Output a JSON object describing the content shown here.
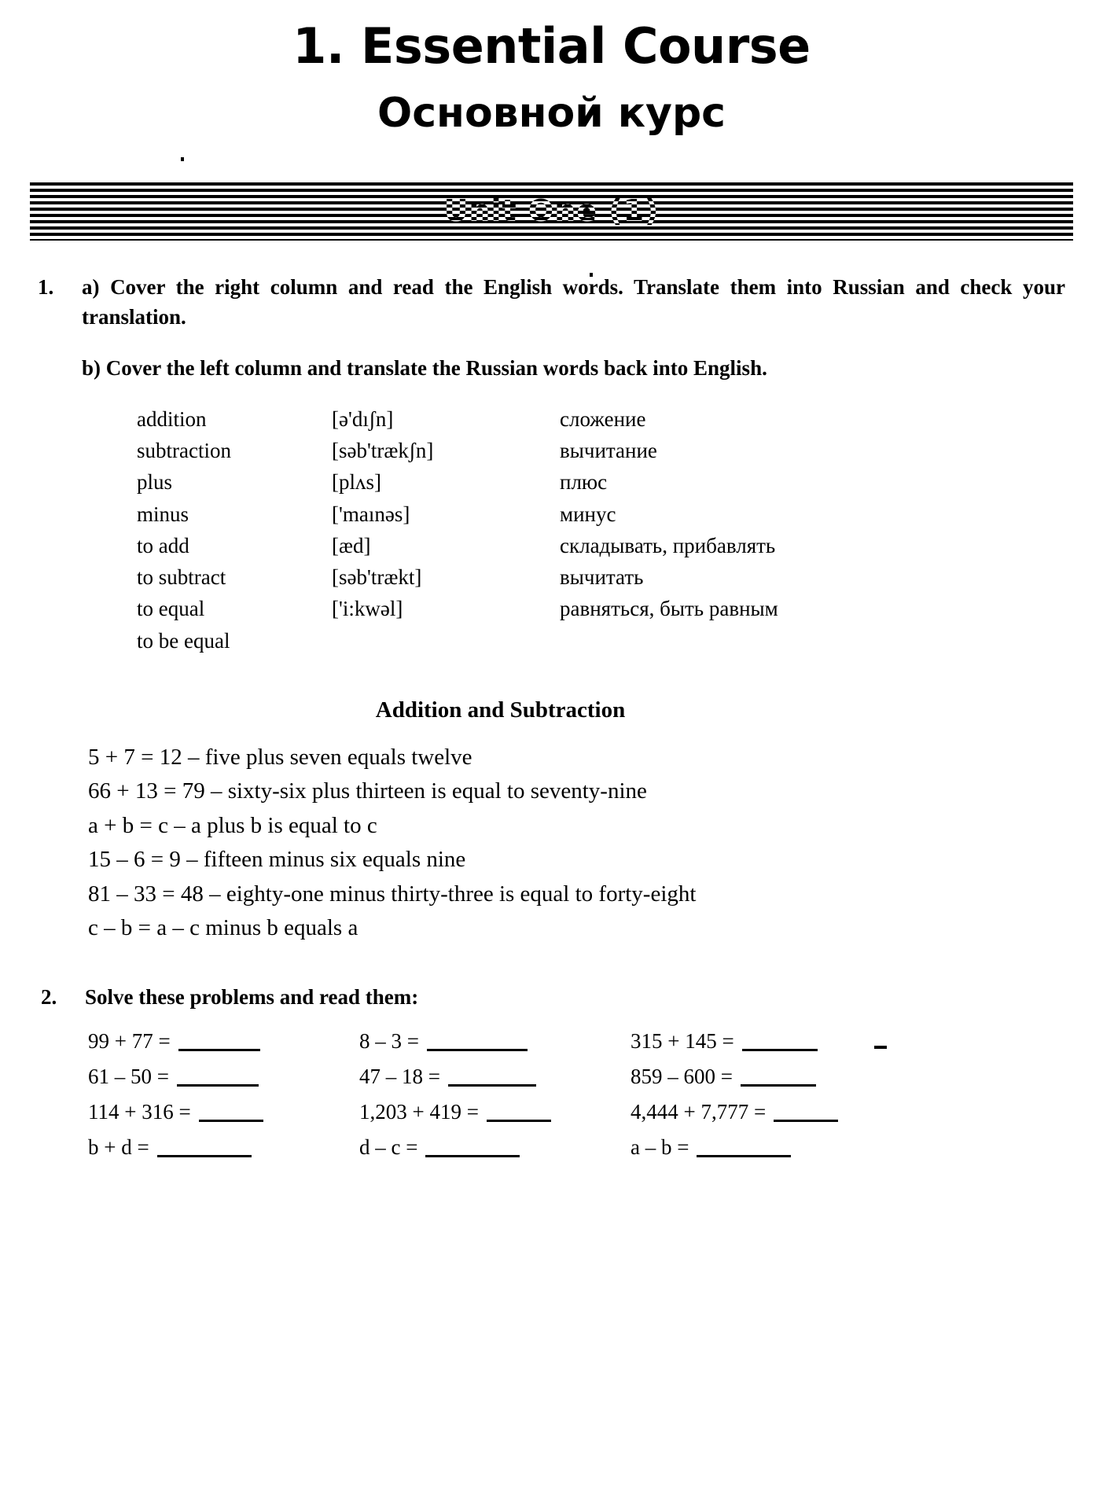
{
  "header": {
    "title_en": "1. Essential Course",
    "title_ru": "Основной курс",
    "unit_banner": "Unit One (1)"
  },
  "exercise1": {
    "number": "1.",
    "instruction_a": "a) Cover the right column and read the English words. Translate them into Russian and check your translation.",
    "instruction_b": "b) Cover the left column and translate the Russian words back into English.",
    "vocabulary": [
      {
        "english": "addition",
        "ipa": "[ə'dıʃn]",
        "russian": "сложение"
      },
      {
        "english": "subtraction",
        "ipa": "[səb'trækʃn]",
        "russian": "вычитание"
      },
      {
        "english": "plus",
        "ipa": "[plʌs]",
        "russian": "плюс"
      },
      {
        "english": "minus",
        "ipa": "['maınəs]",
        "russian": "минус"
      },
      {
        "english": "to add",
        "ipa": "[æd]",
        "russian": "складывать, прибавлять"
      },
      {
        "english": "to subtract",
        "ipa": "[səb'trækt]",
        "russian": "вычитать"
      },
      {
        "english": "to equal",
        "ipa": "['i:kwəl]",
        "russian": "равняться, быть равным"
      },
      {
        "english": "to be equal",
        "ipa": "",
        "russian": ""
      }
    ]
  },
  "addition_subtraction": {
    "heading": "Addition and Subtraction",
    "examples": [
      "5 + 7 = 12 – five plus seven equals twelve",
      "66 + 13 = 79 – sixty-six plus thirteen is equal to seventy-nine",
      "a + b = c – a plus b is equal to c",
      "15 – 6 = 9 – fifteen minus six equals nine",
      "81 – 33 = 48 – eighty-one minus thirty-three is equal to forty-eight",
      "c – b = a – c minus b equals a"
    ]
  },
  "exercise2": {
    "number": "2.",
    "instruction": "Solve these problems and read them:",
    "problems": [
      [
        {
          "expr": "99 + 77 =",
          "blank": "w1"
        },
        {
          "expr": "8 – 3 =",
          "blank": "w5"
        },
        {
          "expr": "315 + 145 =",
          "blank": "w3"
        }
      ],
      [
        {
          "expr": "61 – 50 =",
          "blank": "w1"
        },
        {
          "expr": "47 – 18 =",
          "blank": "w2"
        },
        {
          "expr": "859 – 600 =",
          "blank": "w3"
        }
      ],
      [
        {
          "expr": "114 + 316 =",
          "blank": "w4"
        },
        {
          "expr": "1,203 + 419 =",
          "blank": "w4"
        },
        {
          "expr": "4,444 + 7,777 =",
          "blank": "w4"
        }
      ],
      [
        {
          "expr": "b + d =",
          "blank": "w6"
        },
        {
          "expr": "d – c =",
          "blank": "w6"
        },
        {
          "expr": "a – b =",
          "blank": "w6"
        }
      ]
    ]
  }
}
